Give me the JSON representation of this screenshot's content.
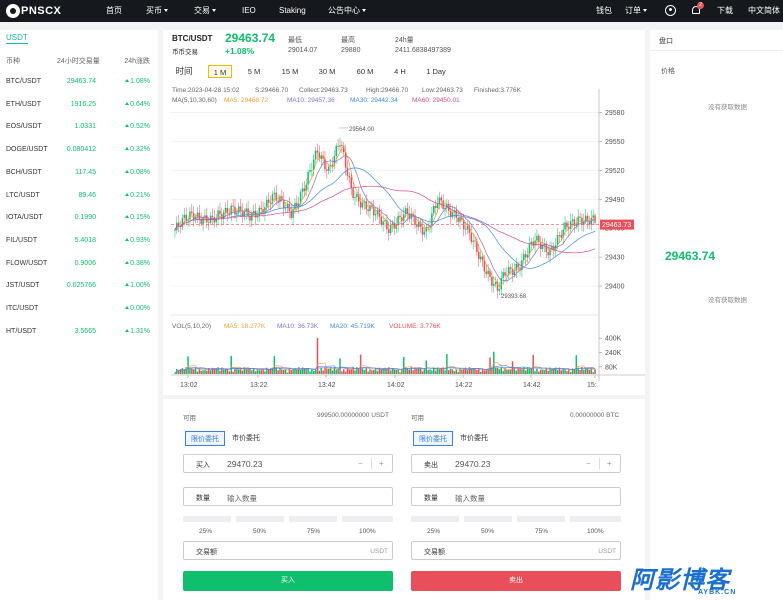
{
  "nav": {
    "logo": "PNSCX",
    "items": [
      "首页",
      "买币",
      "交易",
      "IEO",
      "Staking",
      "公告中心"
    ],
    "right": [
      "钱包",
      "订单",
      "下载",
      "中文简体"
    ],
    "badge": "2"
  },
  "market": {
    "tab": "USDT",
    "headers": [
      "币种",
      "24小时交易量",
      "24h涨跌"
    ],
    "rows": [
      {
        "symbol": "BTC/USDT",
        "price": "29463.74",
        "change": "1.08%"
      },
      {
        "symbol": "ETH/USDT",
        "price": "1916.25",
        "change": "0.64%"
      },
      {
        "symbol": "EOS/USDT",
        "price": "1.0331",
        "change": "0.52%"
      },
      {
        "symbol": "DOGE/USDT",
        "price": "0.080412",
        "change": "0.32%"
      },
      {
        "symbol": "BCH/USDT",
        "price": "117.45",
        "change": "0.08%"
      },
      {
        "symbol": "LTC/USDT",
        "price": "89.46",
        "change": "0.21%"
      },
      {
        "symbol": "IOTA/USDT",
        "price": "0.1990",
        "change": "0.15%"
      },
      {
        "symbol": "FIL/USDT",
        "price": "5.4018",
        "change": "0.93%"
      },
      {
        "symbol": "FLOW/USDT",
        "price": "0.9006",
        "change": "0.38%"
      },
      {
        "symbol": "JST/USDT",
        "price": "0.025766",
        "change": "1.00%"
      },
      {
        "symbol": "ITC/USDT",
        "price": "",
        "change": "0.00%"
      },
      {
        "symbol": "HT/USDT",
        "price": "3.5665",
        "change": "1.31%"
      }
    ]
  },
  "ticker": {
    "pair": "BTC/USDT",
    "type": "币币交易",
    "price": "29463.74",
    "change": "+1.08%",
    "low_label": "最低",
    "low": "29014.07",
    "high_label": "最高",
    "high": "29880",
    "vol_label": "24h量",
    "vol": "2411.6838497389"
  },
  "timeframes": [
    "时间",
    "1 M",
    "5 M",
    "15 M",
    "30 M",
    "60 M",
    "4 H",
    "1 Day"
  ],
  "info": {
    "line1": [
      "Time:2023-04-28 15:02",
      "S:29466.70",
      "Collect:29463.73",
      "High:29466.70",
      "Low:29463.73",
      "Finished:3.776K"
    ],
    "ma": "MA(5,10,30,60)",
    "ma5": "MA5: 29468.72",
    "ma10": "MA10: 29457.36",
    "ma30": "MA30: 29442.34",
    "ma60": "MA60: 29450.01",
    "vol": "VOL(5,10,20)",
    "vma5": "MA5: 18.277K",
    "vma10": "MA10: 36.73K",
    "vma20": "MA20: 45.719K",
    "volume": "VOLUME: 3.776K"
  },
  "colors": {
    "up": "#0fbf6d",
    "down": "#e84f5b",
    "ma5": "#f0a030",
    "ma10": "#8a6fd6",
    "ma30": "#3d8ee6",
    "ma60": "#d84b8f"
  },
  "chart_data": {
    "type": "candlestick",
    "x_ticks": [
      "13:02",
      "13:22",
      "13:42",
      "14:02",
      "14:22",
      "14:42",
      "15:"
    ],
    "y_ticks": [
      29580,
      29550,
      29520,
      29490,
      29460,
      29430,
      29400
    ],
    "ylim": [
      29372,
      29592
    ],
    "last_price": "29463.73",
    "high_mark": "29564.00",
    "low_mark": "29393.68",
    "vol_ticks": [
      "400K",
      "240K",
      "80K"
    ],
    "vol_ylim": [
      0,
      480
    ]
  },
  "form": {
    "avail_label": "可用",
    "buy_avail": "999500.00000000 USDT",
    "sell_avail": "0.00000000 BTC",
    "tab_limit": "限价委托",
    "tab_market": "市价委托",
    "buy_label": "买入",
    "sell_label": "卖出",
    "price": "29470.23",
    "qty_label": "数量",
    "qty_placeholder": "输入数量",
    "pcts": [
      "25%",
      "50%",
      "75%",
      "100%"
    ],
    "amount_label": "交易额",
    "unit": "USDT",
    "buy_button": "买入",
    "sell_button": "卖出"
  },
  "orderbook": {
    "title": "盘口",
    "price_label": "价格",
    "empty": "没有获取数据",
    "price": "29463.74"
  },
  "watermark": {
    "brand": "阿影博客",
    "domain": "AYBK.CN"
  }
}
